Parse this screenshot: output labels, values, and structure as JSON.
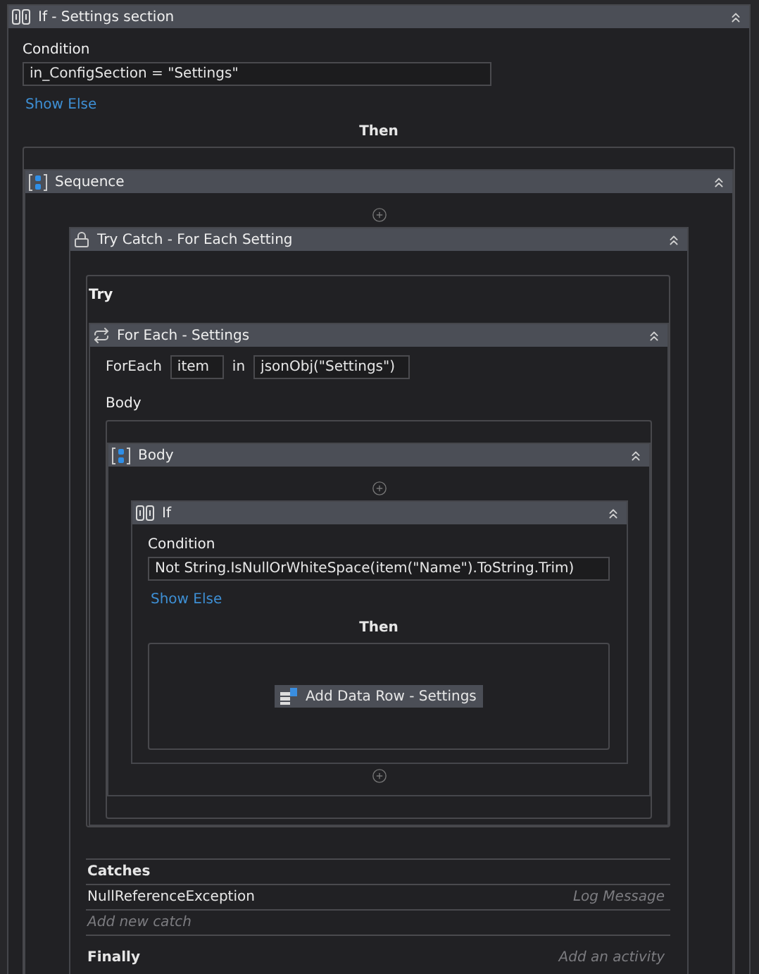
{
  "workflow": {
    "kind": "if",
    "title": "If -  Settings section",
    "condition_label": "Condition",
    "condition": "in_ConfigSection = \"Settings\"",
    "show_else": "Show Else",
    "then_label": "Then",
    "then": {
      "kind": "sequence",
      "title": "Sequence",
      "children": [
        {
          "kind": "trycatch",
          "title": "Try Catch - For Each Setting",
          "try_label": "Try",
          "try": {
            "kind": "foreach",
            "title": "For Each - Settings",
            "foreach_label": "ForEach",
            "variable": "item",
            "in_label": "in",
            "collection": "jsonObj(\"Settings\")",
            "body_label": "Body",
            "body": {
              "kind": "sequence",
              "title": "Body",
              "children": [
                {
                  "kind": "if",
                  "title": "If",
                  "condition_label": "Condition",
                  "condition": "Not String.IsNullOrWhiteSpace(item(\"Name\").ToString.Trim)",
                  "show_else": "Show Else",
                  "then_label": "Then",
                  "then": {
                    "kind": "activity",
                    "title": "Add Data Row - Settings"
                  }
                }
              ]
            }
          },
          "catches_label": "Catches",
          "catches": [
            {
              "exception": "NullReferenceException",
              "action": "Log Message"
            }
          ],
          "add_catch": "Add new catch",
          "finally_label": "Finally",
          "finally_hint": "Add an activity"
        }
      ]
    }
  }
}
